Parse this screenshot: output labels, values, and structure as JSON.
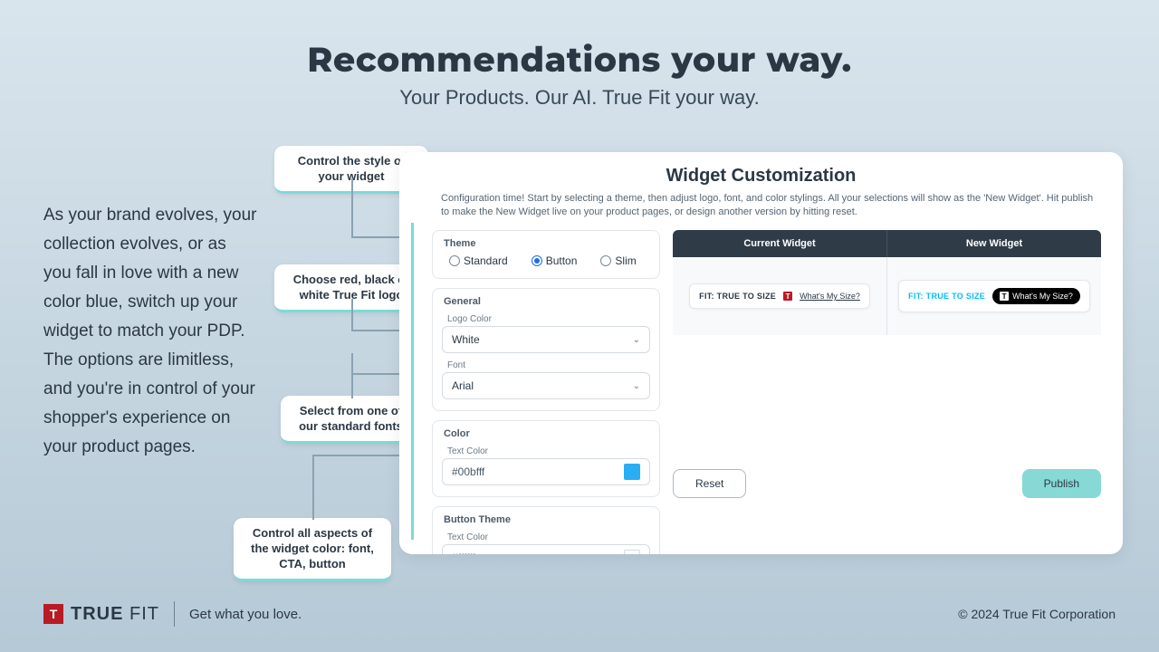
{
  "hero": {
    "title": "Recommendations your way.",
    "subtitle": "Your Products. Our AI. True Fit your way."
  },
  "copy": "As your brand evolves, your collection evolves, or as you fall in love with a new color blue, switch up your widget to match your PDP. The options are limitless, and you're in control of your shopper's experience on your product pages.",
  "callouts": {
    "style": "Control the style of your widget",
    "logo": "Choose red, black or white True Fit logo",
    "font": "Select from one of our standard fonts",
    "color": "Control all aspects of the widget color: font, CTA, button"
  },
  "panel": {
    "title": "Widget Customization",
    "subtitle": "Configuration time! Start by selecting a theme, then adjust logo, font, and color stylings. All your selections will show as the 'New Widget'. Hit publish to make the New Widget live on your product pages, or design another version by hitting reset.",
    "theme": {
      "label": "Theme",
      "options": {
        "standard": "Standard",
        "button": "Button",
        "slim": "Slim"
      },
      "selected": "button"
    },
    "general": {
      "label": "General",
      "logo_color_label": "Logo Color",
      "logo_color_value": "White",
      "font_label": "Font",
      "font_value": "Arial"
    },
    "color": {
      "label": "Color",
      "text_color_label": "Text Color",
      "text_color_value": "#00bfff",
      "swatch": "#29aef2"
    },
    "button_theme": {
      "label": "Button Theme",
      "text_color_label": "Text Color",
      "text_color_value": "#ffffff",
      "swatch": "#ffffff"
    },
    "preview": {
      "current_label": "Current Widget",
      "new_label": "New Widget",
      "fit_text": "FIT: TRUE TO SIZE",
      "wms": "What's My Size?",
      "new_fit_color": "#00bfff"
    },
    "actions": {
      "reset": "Reset",
      "publish": "Publish"
    }
  },
  "footer": {
    "brand_true": "TRUE",
    "brand_fit": "FIT",
    "tagline": "Get what you love.",
    "copyright": "© 2024 True Fit Corporation"
  }
}
